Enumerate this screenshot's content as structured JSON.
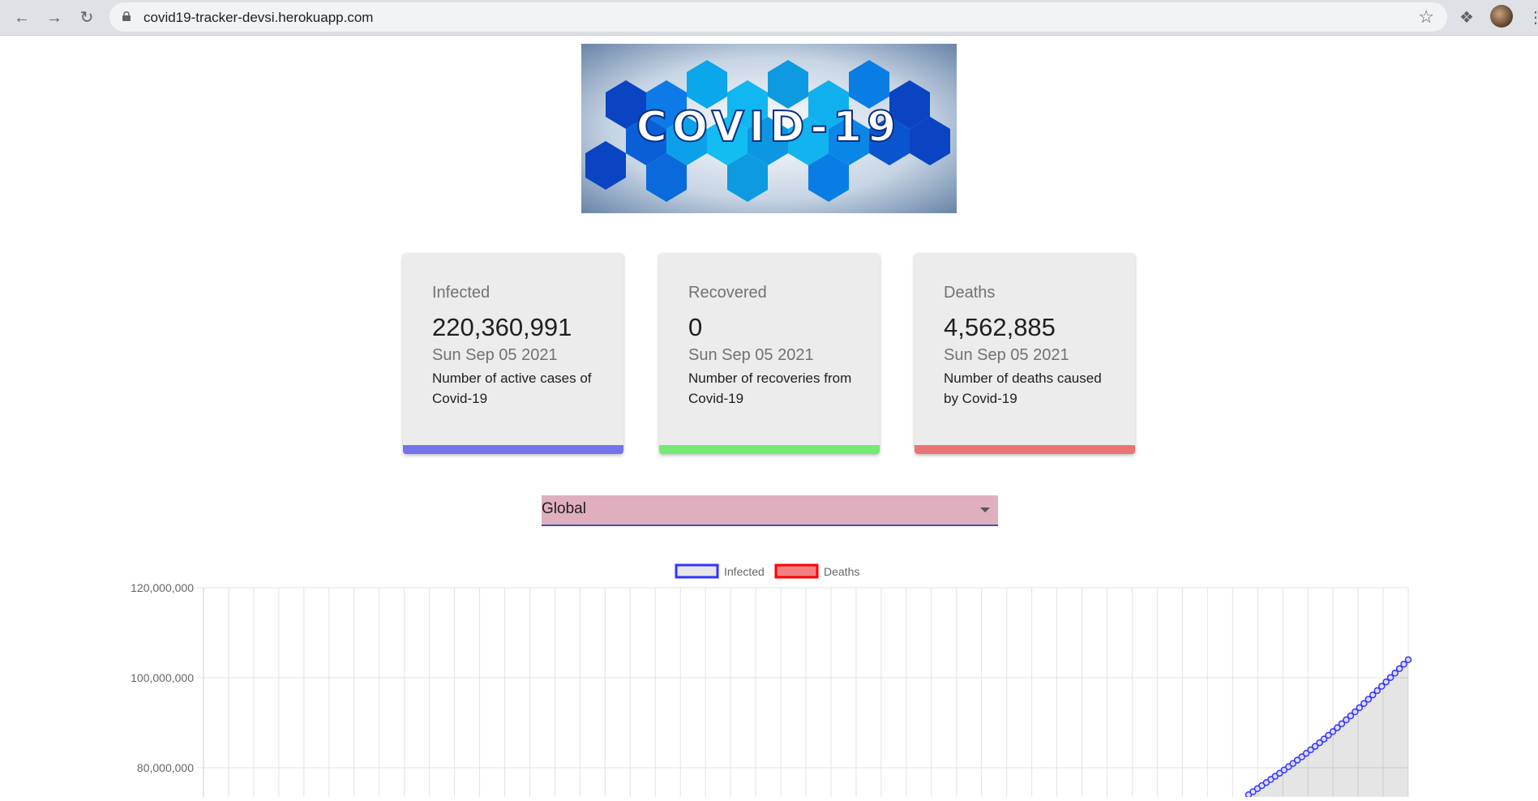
{
  "browser": {
    "url": "covid19-tracker-devsi.herokuapp.com"
  },
  "hero": {
    "logo_text": "COVID-19"
  },
  "cards": [
    {
      "title": "Infected",
      "value": "220,360,991",
      "date": "Sun Sep 05 2021",
      "description": "Number of active cases of Covid-19",
      "accent": "#7373ea"
    },
    {
      "title": "Recovered",
      "value": "0",
      "date": "Sun Sep 05 2021",
      "description": "Number of recoveries from Covid-19",
      "accent": "#73ea73"
    },
    {
      "title": "Deaths",
      "value": "4,562,885",
      "date": "Sun Sep 05 2021",
      "description": "Number of deaths caused by Covid-19",
      "accent": "#ea7373"
    }
  ],
  "country_select": {
    "selected": "Global"
  },
  "chart_data": {
    "type": "line",
    "legend_placement": "top",
    "grid": true,
    "series": [
      {
        "name": "Infected",
        "color": "#3333ff",
        "fill": "rgba(0,0,0,0.1)"
      },
      {
        "name": "Deaths",
        "color": "#ff0000",
        "fill": "rgba(255,0,0,0.5)"
      }
    ],
    "y_ticks": [
      "120,000,000",
      "100,000,000",
      "80,000,000"
    ],
    "ylim": [
      70000000,
      120000000
    ],
    "visible_infected_tail": [
      74000000,
      104000000
    ]
  }
}
